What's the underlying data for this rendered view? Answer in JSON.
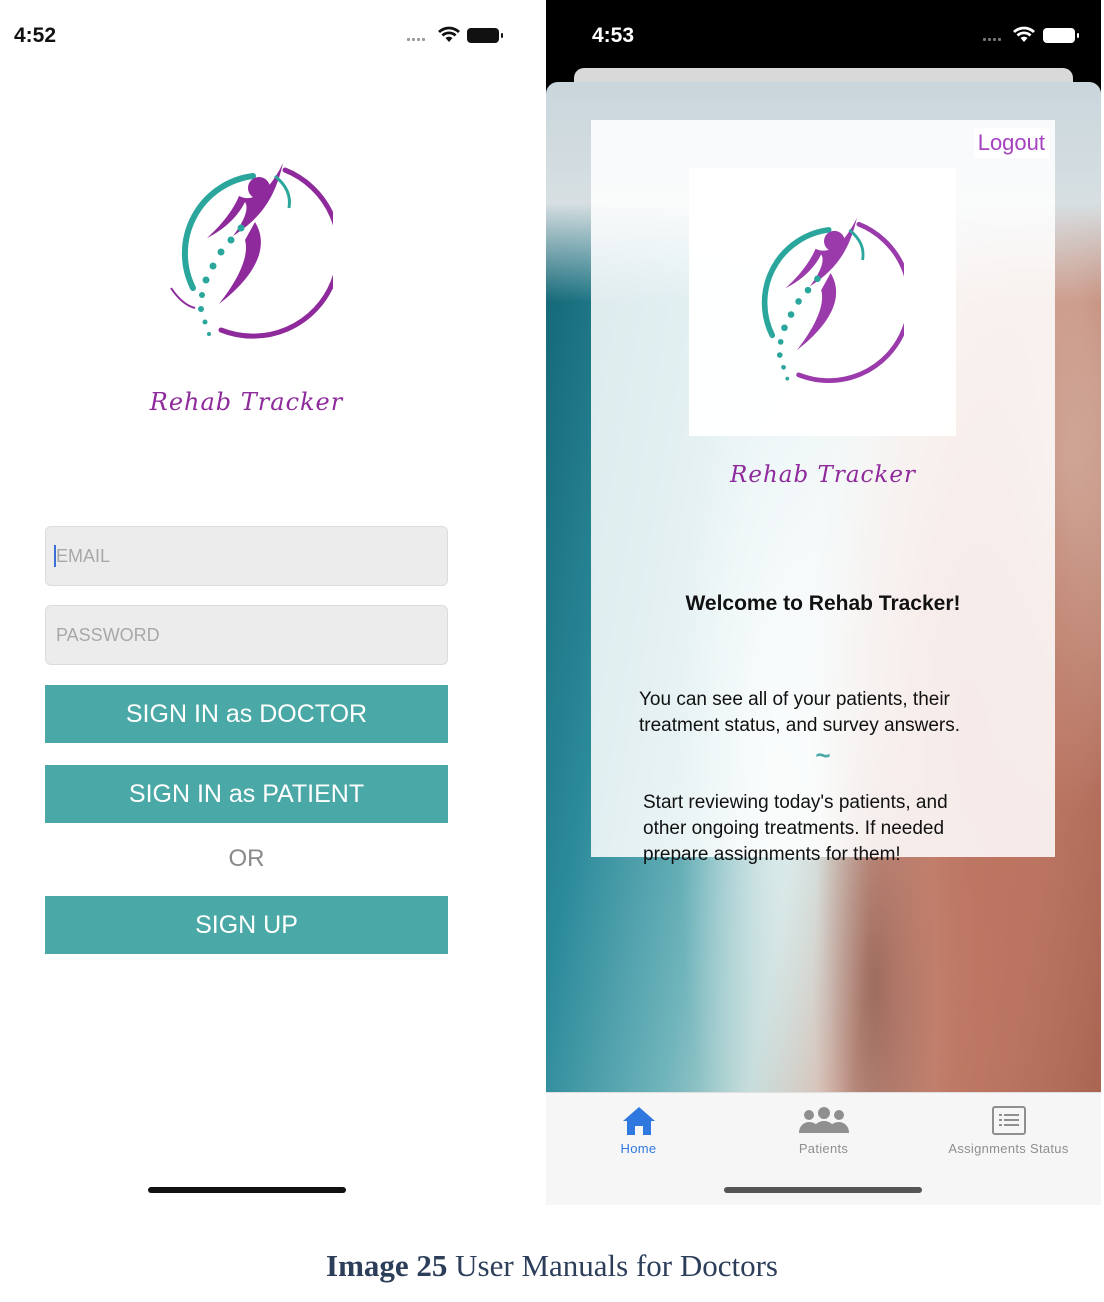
{
  "left_screen": {
    "status_time": "4:52",
    "brand_name": "Rehab Tracker",
    "email_placeholder": "EMAIL",
    "password_placeholder": "PASSWORD",
    "sign_in_doctor_label": "SIGN IN as DOCTOR",
    "sign_in_patient_label": "SIGN IN as PATIENT",
    "or_label": "OR",
    "sign_up_label": "SIGN UP"
  },
  "right_screen": {
    "status_time": "4:53",
    "logout_label": "Logout",
    "brand_name": "Rehab Tracker",
    "welcome_heading": "Welcome to Rehab Tracker!",
    "intro_line_1": "You can see all of your patients, their",
    "intro_line_2": "treatment status, and survey answers.",
    "divider": "~",
    "action_line_1": "Start reviewing today's patients, and",
    "action_line_2": "other ongoing treatments. If needed",
    "action_line_3": "prepare assignments for them!",
    "tabs": [
      {
        "label": "Home",
        "icon": "home-icon",
        "active": true
      },
      {
        "label": "Patients",
        "icon": "patients-icon",
        "active": false
      },
      {
        "label": "Assignments Status",
        "icon": "assignments-icon",
        "active": false
      }
    ]
  },
  "caption": {
    "label": "Image 25",
    "text": "User Manuals for Doctors"
  },
  "colors": {
    "accent_teal": "#4aa9a6",
    "brand_purple": "#8e2a9c",
    "logout_purple": "#a641c0",
    "active_tab_blue": "#2f78e0"
  }
}
